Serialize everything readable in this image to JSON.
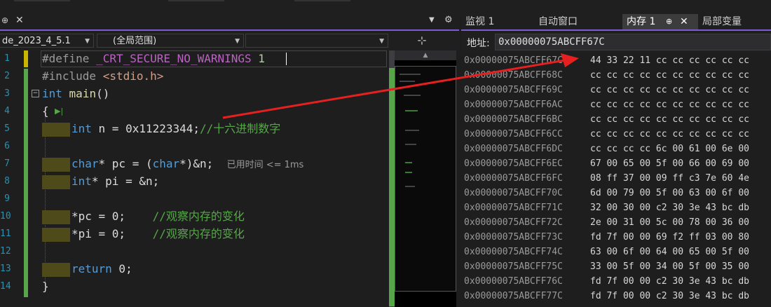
{
  "editor": {
    "tab_pin": "⊕",
    "tab_close": "✕",
    "file_combo": "de_2023_4_5.1",
    "scope_combo": "(全局范围)",
    "member_combo": "",
    "line_numbers": [
      "1",
      "2",
      "3",
      "4",
      "5",
      "6",
      "7",
      "8",
      "9",
      "10",
      "11",
      "12",
      "13",
      "14"
    ],
    "lines": {
      "l1": {
        "directive": "#define",
        "macro": "_CRT_SECURE_NO_WARNINGS",
        "value": "1"
      },
      "l2": {
        "directive": "#include",
        "header": "<stdio.h>"
      },
      "l3": {
        "kw": "int",
        "fn": "main",
        "parens": "()"
      },
      "l4": {
        "brace": "{"
      },
      "l5": {
        "kw": "int",
        "rest": " n = 0x11223344;",
        "comment": "//十六进制数字"
      },
      "l7": {
        "kw": "char",
        "rest1": "* pc = (",
        "kw2": "char",
        "rest2": "*)&n;",
        "elapsed": "已用时间 <= 1ms"
      },
      "l8": {
        "kw": "int",
        "rest": "* pi = &n;"
      },
      "l10": {
        "code": "*pc = 0;",
        "comment": "//观察内存的变化"
      },
      "l11": {
        "code": "*pi = 0;",
        "comment": "//观察内存的变化"
      },
      "l13": {
        "kw": "return",
        "rest": " 0;"
      },
      "l14": {
        "brace": "}"
      }
    }
  },
  "memory": {
    "tabs": [
      {
        "label": "监视 1"
      },
      {
        "label": "自动窗口"
      },
      {
        "label": "内存 1"
      },
      {
        "label": "局部变量"
      }
    ],
    "address_label": "地址:",
    "address_value": "0x00000075ABCFF67C",
    "rows": [
      {
        "addr": "0x00000075ABCFF67C",
        "bytes": "44 33 22 11 cc cc cc cc cc cc"
      },
      {
        "addr": "0x00000075ABCFF68C",
        "bytes": "cc cc cc cc cc cc cc cc cc cc"
      },
      {
        "addr": "0x00000075ABCFF69C",
        "bytes": "cc cc cc cc cc cc cc cc cc cc"
      },
      {
        "addr": "0x00000075ABCFF6AC",
        "bytes": "cc cc cc cc cc cc cc cc cc cc"
      },
      {
        "addr": "0x00000075ABCFF6BC",
        "bytes": "cc cc cc cc cc cc cc cc cc cc"
      },
      {
        "addr": "0x00000075ABCFF6CC",
        "bytes": "cc cc cc cc cc cc cc cc cc cc"
      },
      {
        "addr": "0x00000075ABCFF6DC",
        "bytes": "cc cc cc cc 6c 00 61 00 6e 00"
      },
      {
        "addr": "0x00000075ABCFF6EC",
        "bytes": "67 00 65 00 5f 00 66 00 69 00"
      },
      {
        "addr": "0x00000075ABCFF6FC",
        "bytes": "08 ff 37 00 09 ff c3 7e 60 4e"
      },
      {
        "addr": "0x00000075ABCFF70C",
        "bytes": "6d 00 79 00 5f 00 63 00 6f 00"
      },
      {
        "addr": "0x00000075ABCFF71C",
        "bytes": "32 00 30 00 c2 30 3e 43 bc db"
      },
      {
        "addr": "0x00000075ABCFF72C",
        "bytes": "2e 00 31 00 5c 00 78 00 36 00"
      },
      {
        "addr": "0x00000075ABCFF73C",
        "bytes": "fd 7f 00 00 69 f2 ff 03 00 80"
      },
      {
        "addr": "0x00000075ABCFF74C",
        "bytes": "63 00 6f 00 64 00 65 00 5f 00"
      },
      {
        "addr": "0x00000075ABCFF75C",
        "bytes": "33 00 5f 00 34 00 5f 00 35 00"
      },
      {
        "addr": "0x00000075ABCFF76C",
        "bytes": "fd 7f 00 00 c2 30 3e 43 bc db"
      },
      {
        "addr": "0x00000075ABCFF77C",
        "bytes": "fd 7f 00 00 c2 30 3e 43 bc db"
      }
    ]
  },
  "colors": {
    "arrow": "#e62020",
    "accent": "#7b5cd6",
    "change_bar": "#57a64a"
  }
}
